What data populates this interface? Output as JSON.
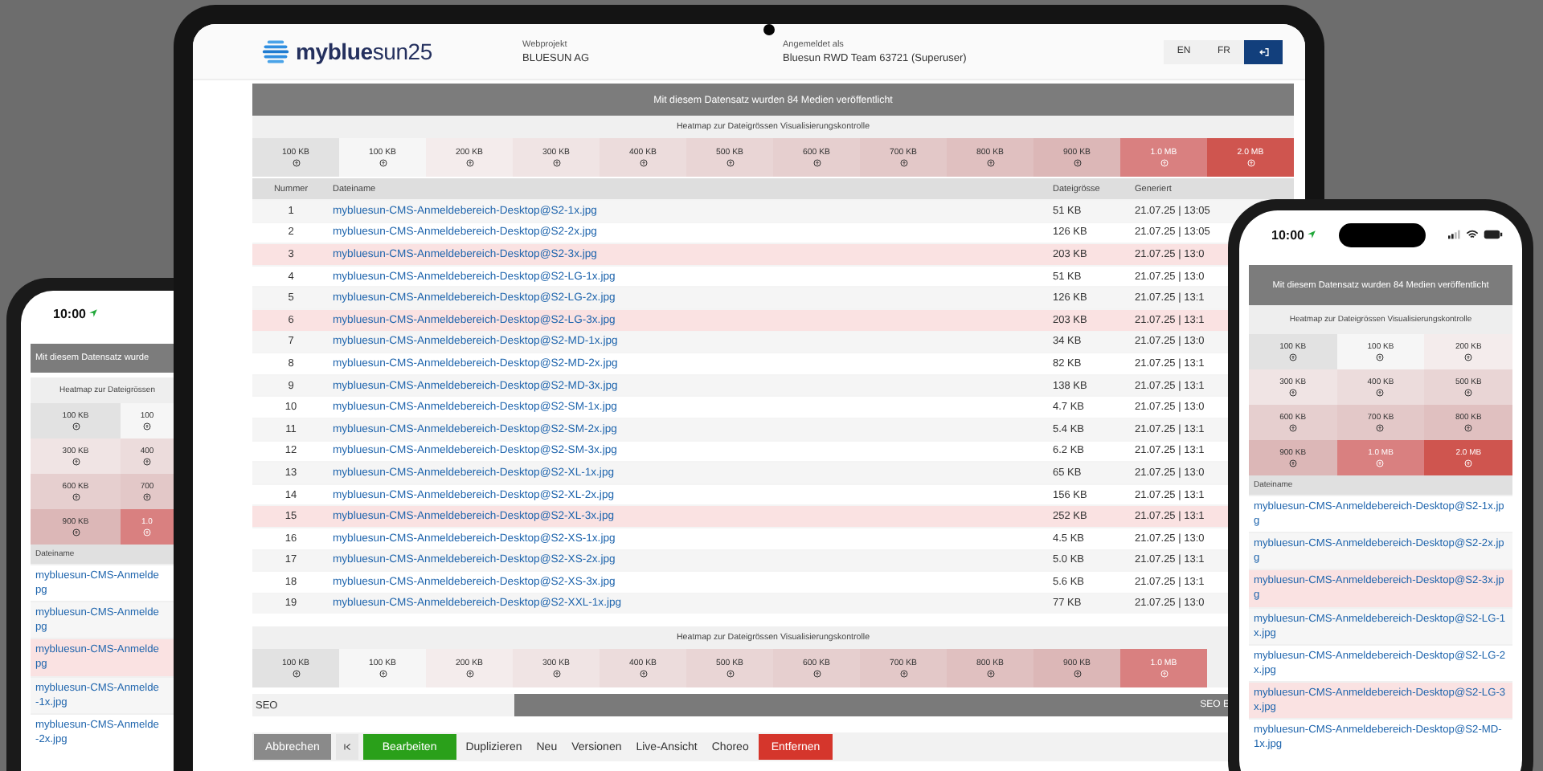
{
  "tablet": {
    "header": {
      "logo": "**myblue**sun25",
      "project_label": "Webprojekt",
      "project": "BLUESUN AG",
      "login_label": "Angemeldet als",
      "user": "Bluesun RWD Team 63721 (Superuser)",
      "languages": [
        "EN",
        "FR"
      ]
    },
    "banner": "Mit diesem Datensatz wurden 84 Medien veröffentlicht",
    "heatmap": {
      "title": "Heatmap zur Dateigrössen Visualisierungskontrolle",
      "cells": [
        {
          "label": "100 KB",
          "color": "#e2e2e2"
        },
        {
          "label": "100 KB",
          "color": "#f6f6f6"
        },
        {
          "label": "200 KB",
          "color": "#f4ecec"
        },
        {
          "label": "300 KB",
          "color": "#f0e4e4"
        },
        {
          "label": "400 KB",
          "color": "#ecdcdc"
        },
        {
          "label": "500 KB",
          "color": "#e9d5d5"
        },
        {
          "label": "600 KB",
          "color": "#e6cfcf"
        },
        {
          "label": "700 KB",
          "color": "#e3c8c8"
        },
        {
          "label": "800 KB",
          "color": "#e0c0c0"
        },
        {
          "label": "900 KB",
          "color": "#dcb7b7"
        },
        {
          "label": "1.0 MB",
          "color": "#d98080"
        },
        {
          "label": "2.0 MB",
          "color": "#cf554f"
        }
      ]
    },
    "table": {
      "columns": [
        "Nummer",
        "Dateiname",
        "Dateigrösse",
        "Generiert"
      ],
      "rows": [
        {
          "number": "1",
          "file": "mybluesun-CMS-Anmeldebereich-Desktop@S2-1x.jpg",
          "size": "51 KB",
          "generated": "21.07.25 | 13:05",
          "highlighted": false
        },
        {
          "number": "2",
          "file": "mybluesun-CMS-Anmeldebereich-Desktop@S2-2x.jpg",
          "size": "126 KB",
          "generated": "21.07.25 | 13:05",
          "highlighted": false
        },
        {
          "number": "3",
          "file": "mybluesun-CMS-Anmeldebereich-Desktop@S2-3x.jpg",
          "size": "203 KB",
          "generated": "21.07.25 | 13:0",
          "highlighted": true
        },
        {
          "number": "4",
          "file": "mybluesun-CMS-Anmeldebereich-Desktop@S2-LG-1x.jpg",
          "size": "51 KB",
          "generated": "21.07.25 | 13:0",
          "highlighted": false
        },
        {
          "number": "5",
          "file": "mybluesun-CMS-Anmeldebereich-Desktop@S2-LG-2x.jpg",
          "size": "126 KB",
          "generated": "21.07.25 | 13:1",
          "highlighted": false
        },
        {
          "number": "6",
          "file": "mybluesun-CMS-Anmeldebereich-Desktop@S2-LG-3x.jpg",
          "size": "203 KB",
          "generated": "21.07.25 | 13:1",
          "highlighted": true
        },
        {
          "number": "7",
          "file": "mybluesun-CMS-Anmeldebereich-Desktop@S2-MD-1x.jpg",
          "size": "34 KB",
          "generated": "21.07.25 | 13:0",
          "highlighted": false
        },
        {
          "number": "8",
          "file": "mybluesun-CMS-Anmeldebereich-Desktop@S2-MD-2x.jpg",
          "size": "82 KB",
          "generated": "21.07.25 | 13:1",
          "highlighted": false
        },
        {
          "number": "9",
          "file": "mybluesun-CMS-Anmeldebereich-Desktop@S2-MD-3x.jpg",
          "size": "138 KB",
          "generated": "21.07.25 | 13:1",
          "highlighted": false
        },
        {
          "number": "10",
          "file": "mybluesun-CMS-Anmeldebereich-Desktop@S2-SM-1x.jpg",
          "size": "4.7 KB",
          "generated": "21.07.25 | 13:0",
          "highlighted": false
        },
        {
          "number": "11",
          "file": "mybluesun-CMS-Anmeldebereich-Desktop@S2-SM-2x.jpg",
          "size": "5.4 KB",
          "generated": "21.07.25 | 13:1",
          "highlighted": false
        },
        {
          "number": "12",
          "file": "mybluesun-CMS-Anmeldebereich-Desktop@S2-SM-3x.jpg",
          "size": "6.2 KB",
          "generated": "21.07.25 | 13:1",
          "highlighted": false
        },
        {
          "number": "13",
          "file": "mybluesun-CMS-Anmeldebereich-Desktop@S2-XL-1x.jpg",
          "size": "65 KB",
          "generated": "21.07.25 | 13:0",
          "highlighted": false
        },
        {
          "number": "14",
          "file": "mybluesun-CMS-Anmeldebereich-Desktop@S2-XL-2x.jpg",
          "size": "156 KB",
          "generated": "21.07.25 | 13:1",
          "highlighted": false
        },
        {
          "number": "15",
          "file": "mybluesun-CMS-Anmeldebereich-Desktop@S2-XL-3x.jpg",
          "size": "252 KB",
          "generated": "21.07.25 | 13:1",
          "highlighted": true
        },
        {
          "number": "16",
          "file": "mybluesun-CMS-Anmeldebereich-Desktop@S2-XS-1x.jpg",
          "size": "4.5 KB",
          "generated": "21.07.25 | 13:0",
          "highlighted": false
        },
        {
          "number": "17",
          "file": "mybluesun-CMS-Anmeldebereich-Desktop@S2-XS-2x.jpg",
          "size": "5.0 KB",
          "generated": "21.07.25 | 13:1",
          "highlighted": false
        },
        {
          "number": "18",
          "file": "mybluesun-CMS-Anmeldebereich-Desktop@S2-XS-3x.jpg",
          "size": "5.6 KB",
          "generated": "21.07.25 | 13:1",
          "highlighted": false
        },
        {
          "number": "19",
          "file": "mybluesun-CMS-Anmeldebereich-Desktop@S2-XXL-1x.jpg",
          "size": "77 KB",
          "generated": "21.07.25 | 13:0",
          "highlighted": false
        }
      ]
    },
    "heatmap_bottom": {
      "title": "Heatmap zur Dateigrössen Visualisierungskontrolle",
      "cells": [
        {
          "label": "100 KB",
          "color": "#e2e2e2"
        },
        {
          "label": "100 KB",
          "color": "#f6f6f6"
        },
        {
          "label": "200 KB",
          "color": "#f4ecec"
        },
        {
          "label": "300 KB",
          "color": "#f0e4e4"
        },
        {
          "label": "400 KB",
          "color": "#ecdcdc"
        },
        {
          "label": "500 KB",
          "color": "#e9d5d5"
        },
        {
          "label": "600 KB",
          "color": "#e6cfcf"
        },
        {
          "label": "700 KB",
          "color": "#e3c8c8"
        },
        {
          "label": "800 KB",
          "color": "#e0c0c0"
        },
        {
          "label": "900 KB",
          "color": "#dcb7b7"
        },
        {
          "label": "1.0 MB",
          "color": "#d98080"
        }
      ]
    },
    "seo": {
      "label": "SEO",
      "bar": "SEO E"
    },
    "actions": [
      {
        "label": "Abbrechen",
        "kind": "cancel"
      },
      {
        "kind": "icon"
      },
      {
        "label": "Bearbeiten",
        "kind": "primary"
      },
      {
        "label": "Duplizieren",
        "kind": "plain"
      },
      {
        "label": "Neu",
        "kind": "plain"
      },
      {
        "label": "Versionen",
        "kind": "plain"
      },
      {
        "label": "Live-Ansicht",
        "kind": "plain"
      },
      {
        "label": "Choreo",
        "kind": "plain"
      },
      {
        "label": "Entfernen",
        "kind": "danger"
      }
    ]
  },
  "phone_right": {
    "time": "10:00",
    "banner": "Mit diesem Datensatz wurden 84 Medien veröffentlicht",
    "heatmap": {
      "title": "Heatmap zur Dateigrössen Visualisierungskontrolle",
      "cells": [
        {
          "label": "100 KB",
          "color": "#e2e2e2"
        },
        {
          "label": "100 KB",
          "color": "#f6f6f6"
        },
        {
          "label": "200 KB",
          "color": "#f4ecec"
        },
        {
          "label": "300 KB",
          "color": "#f0e4e4"
        },
        {
          "label": "400 KB",
          "color": "#ecdcdc"
        },
        {
          "label": "500 KB",
          "color": "#e9d5d5"
        },
        {
          "label": "600 KB",
          "color": "#e6cfcf"
        },
        {
          "label": "700 KB",
          "color": "#e3c8c8"
        },
        {
          "label": "800 KB",
          "color": "#e0c0c0"
        },
        {
          "label": "900 KB",
          "color": "#dcb7b7"
        },
        {
          "label": "1.0 MB",
          "color": "#d98080"
        },
        {
          "label": "2.0 MB",
          "color": "#cf554f"
        }
      ]
    },
    "column": "Dateiname",
    "files": [
      {
        "file": "mybluesun-CMS-Anmeldebereich-Desktop@S2-1x.jpg",
        "highlighted": false
      },
      {
        "file": "mybluesun-CMS-Anmeldebereich-Desktop@S2-2x.jpg",
        "highlighted": false
      },
      {
        "file": "mybluesun-CMS-Anmeldebereich-Desktop@S2-3x.jpg",
        "highlighted": true
      },
      {
        "file": "mybluesun-CMS-Anmeldebereich-Desktop@S2-LG-1x.jpg",
        "highlighted": false
      },
      {
        "file": "mybluesun-CMS-Anmeldebereich-Desktop@S2-LG-2x.jpg",
        "highlighted": false
      },
      {
        "file": "mybluesun-CMS-Anmeldebereich-Desktop@S2-LG-3x.jpg",
        "highlighted": true
      },
      {
        "file": "mybluesun-CMS-Anmeldebereich-Desktop@S2-MD-1x.jpg",
        "highlighted": false
      }
    ]
  },
  "phone_left": {
    "time": "10:00",
    "banner": "Mit diesem Datensatz wurde",
    "heatmap": {
      "title": "Heatmap zur Dateigrössen",
      "cells": [
        {
          "label": "100 KB",
          "color": "#e2e2e2"
        },
        {
          "label": "100",
          "color": "#f6f6f6"
        },
        {
          "label": "300 KB",
          "color": "#f0e4e4"
        },
        {
          "label": "400",
          "color": "#ecdcdc"
        },
        {
          "label": "600 KB",
          "color": "#e6cfcf"
        },
        {
          "label": "700",
          "color": "#e3c8c8"
        },
        {
          "label": "900 KB",
          "color": "#dcb7b7"
        },
        {
          "label": "1.0",
          "color": "#d98080"
        }
      ]
    },
    "column": "Dateiname",
    "files": [
      {
        "file": "mybluesun-CMS-Anmelde\npg",
        "highlighted": false
      },
      {
        "file": "mybluesun-CMS-Anmelde\npg",
        "highlighted": false
      },
      {
        "file": "mybluesun-CMS-Anmelde\npg",
        "highlighted": true
      },
      {
        "file": "mybluesun-CMS-Anmelde\n-1x.jpg",
        "highlighted": false
      },
      {
        "file": "mybluesun-CMS-Anmelde\n-2x.jpg",
        "highlighted": false
      }
    ]
  }
}
